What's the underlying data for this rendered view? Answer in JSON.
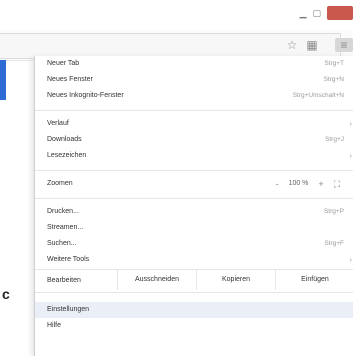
{
  "browser": {
    "toolbar_icons": [
      "star-icon",
      "grid-icon",
      "menu-icon"
    ]
  },
  "page": {
    "stray_text": "c"
  },
  "menu": {
    "items_group1": [
      {
        "label": "Neuer Tab",
        "shortcut": "Strg+T"
      },
      {
        "label": "Neues Fenster",
        "shortcut": "Strg+N"
      },
      {
        "label": "Neues Inkognito-Fenster",
        "shortcut": "Strg+Umschalt+N"
      }
    ],
    "items_group2": [
      {
        "label": "Verlauf",
        "shortcut": ""
      },
      {
        "label": "Downloads",
        "shortcut": "Strg+J"
      },
      {
        "label": "Lesezeichen",
        "shortcut": ""
      }
    ],
    "zoom": {
      "label": "Zoomen",
      "minus": "-",
      "value": "100 %",
      "plus": "+",
      "fullscreen": "⛶"
    },
    "items_group3": [
      {
        "label": "Drucken...",
        "shortcut": "Strg+P"
      },
      {
        "label": "Streamen...",
        "shortcut": ""
      },
      {
        "label": "Suchen...",
        "shortcut": "Strg+F"
      },
      {
        "label": "Weitere Tools",
        "shortcut": ""
      }
    ],
    "edit": {
      "label": "Bearbeiten",
      "cut": "Ausschneiden",
      "copy": "Kopieren",
      "paste": "Einfügen"
    },
    "items_group4": [
      {
        "label": "Einstellungen",
        "shortcut": ""
      },
      {
        "label": "Hilfe",
        "shortcut": ""
      }
    ]
  }
}
